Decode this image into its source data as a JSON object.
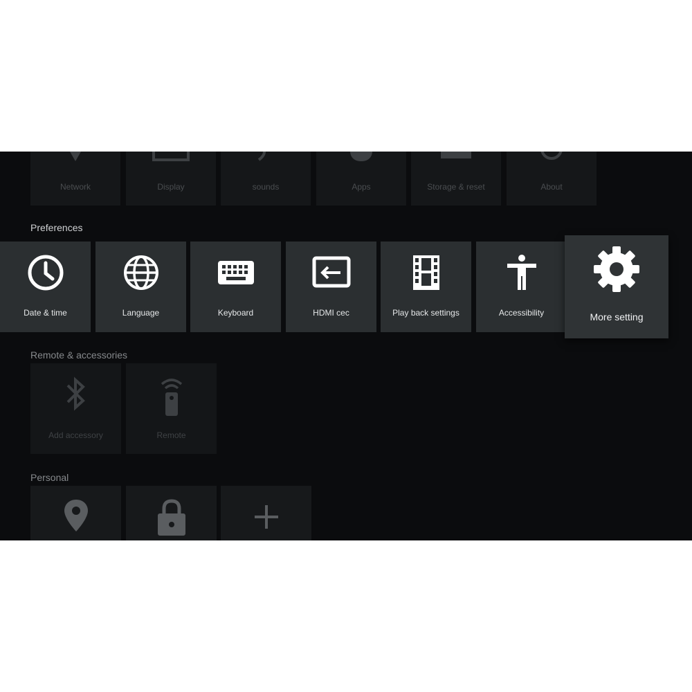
{
  "top_row": [
    {
      "label": "Network",
      "icon": "network-icon"
    },
    {
      "label": "Display",
      "icon": "display-icon"
    },
    {
      "label": "sounds",
      "icon": "sound-icon"
    },
    {
      "label": "Apps",
      "icon": "apps-icon"
    },
    {
      "label": "Storage & reset",
      "icon": "storage-icon"
    },
    {
      "label": "About",
      "icon": "info-icon"
    }
  ],
  "sections": {
    "preferences": "Preferences",
    "remote": "Remote & accessories",
    "personal": "Personal"
  },
  "preferences": [
    {
      "label": "Date & time",
      "icon": "clock-icon"
    },
    {
      "label": "Language",
      "icon": "globe-icon"
    },
    {
      "label": "Keyboard",
      "icon": "keyboard-icon"
    },
    {
      "label": "HDMI cec",
      "icon": "hdmi-input-icon"
    },
    {
      "label": "Play back settings",
      "icon": "film-icon"
    },
    {
      "label": "Accessibility",
      "icon": "accessibility-icon"
    },
    {
      "label": "More setting",
      "icon": "gear-icon",
      "focused": true
    }
  ],
  "remote": [
    {
      "label": "Add accessory",
      "icon": "bluetooth-icon"
    },
    {
      "label": "Remote",
      "icon": "remote-icon"
    }
  ],
  "personal": [
    {
      "label": "",
      "icon": "location-icon"
    },
    {
      "label": "",
      "icon": "lock-icon"
    },
    {
      "label": "",
      "icon": "plus-icon"
    }
  ],
  "colors": {
    "background": "#0b0c0e",
    "tile": "#2b2f31",
    "tile_focus": "#2f3335"
  }
}
